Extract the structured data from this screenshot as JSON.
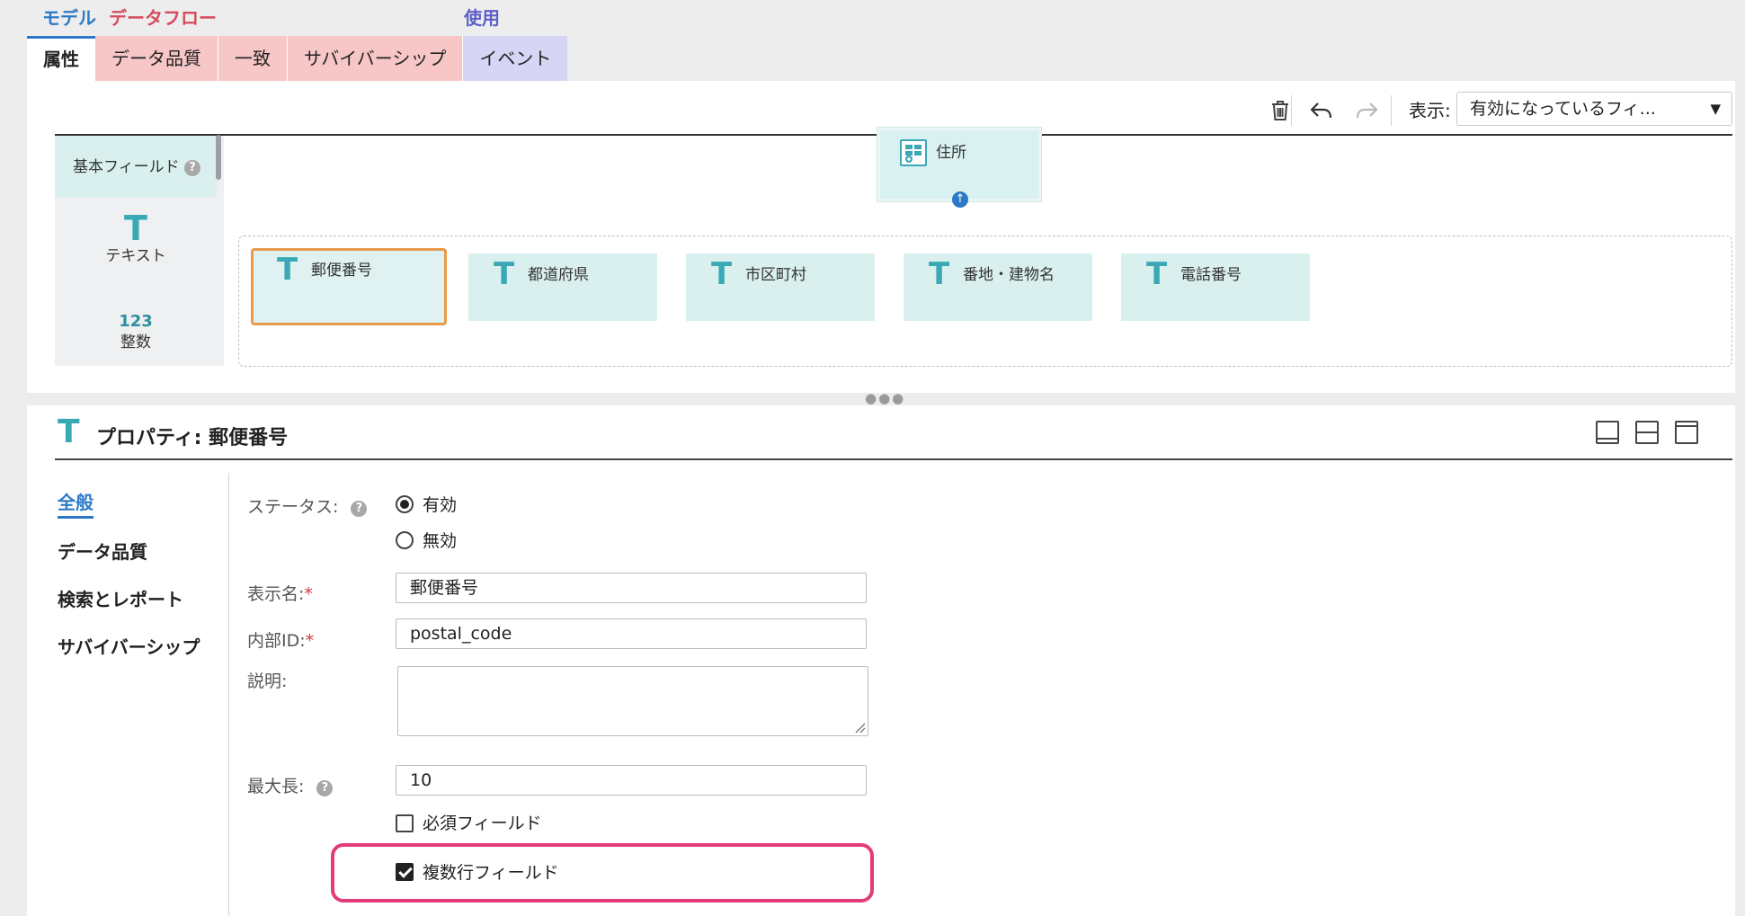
{
  "categories": {
    "model": "モデル",
    "dataflow": "データフロー",
    "usage": "使用"
  },
  "tabs": [
    "属性",
    "データ品質",
    "一致",
    "サバイバーシップ",
    "イベント"
  ],
  "toolbar": {
    "show_label": "表示:",
    "show_value": "有効になっているフィ...",
    "icons": [
      "trash-icon",
      "undo-icon",
      "redo-icon",
      "chevron-down-icon"
    ]
  },
  "palette": {
    "header": "基本フィールド",
    "help": "?",
    "items": [
      {
        "icon": "T",
        "label": "テキスト"
      },
      {
        "icon": "123",
        "label": "整数"
      }
    ]
  },
  "canvas": {
    "parent": {
      "label": "住所",
      "icon": "group-field-icon"
    },
    "children": [
      {
        "icon": "T",
        "label": "郵便番号",
        "selected": true
      },
      {
        "icon": "T",
        "label": "都道府県"
      },
      {
        "icon": "T",
        "label": "市区町村"
      },
      {
        "icon": "T",
        "label": "番地・建物名"
      },
      {
        "icon": "T",
        "label": "電話番号"
      }
    ]
  },
  "properties": {
    "icon": "T",
    "title": "プロパティ: 郵便番号",
    "nav": [
      "全般",
      "データ品質",
      "検索とレポート",
      "サバイバーシップ"
    ],
    "status_label": "ステータス:",
    "status_options": [
      "有効",
      "無効"
    ],
    "status_selected": "有効",
    "display_name_label": "表示名:",
    "display_name": "郵便番号",
    "internal_id_label": "内部ID:",
    "internal_id": "postal_code",
    "description_label": "説明:",
    "description": "",
    "max_length_label": "最大長:",
    "max_length": "10",
    "required_asterisk": "*",
    "checkboxes": [
      {
        "label": "必須フィールド",
        "checked": false
      },
      {
        "label": "複数行フィールド",
        "checked": true
      }
    ],
    "highlight_color": "#e43c7a"
  },
  "colors": {
    "accent": "#2d79c7",
    "teal": "#3aa9b5",
    "pink_tab": "#f7c6c6",
    "lavender_tab": "#d7d5f5",
    "selection": "#e99a4a"
  }
}
